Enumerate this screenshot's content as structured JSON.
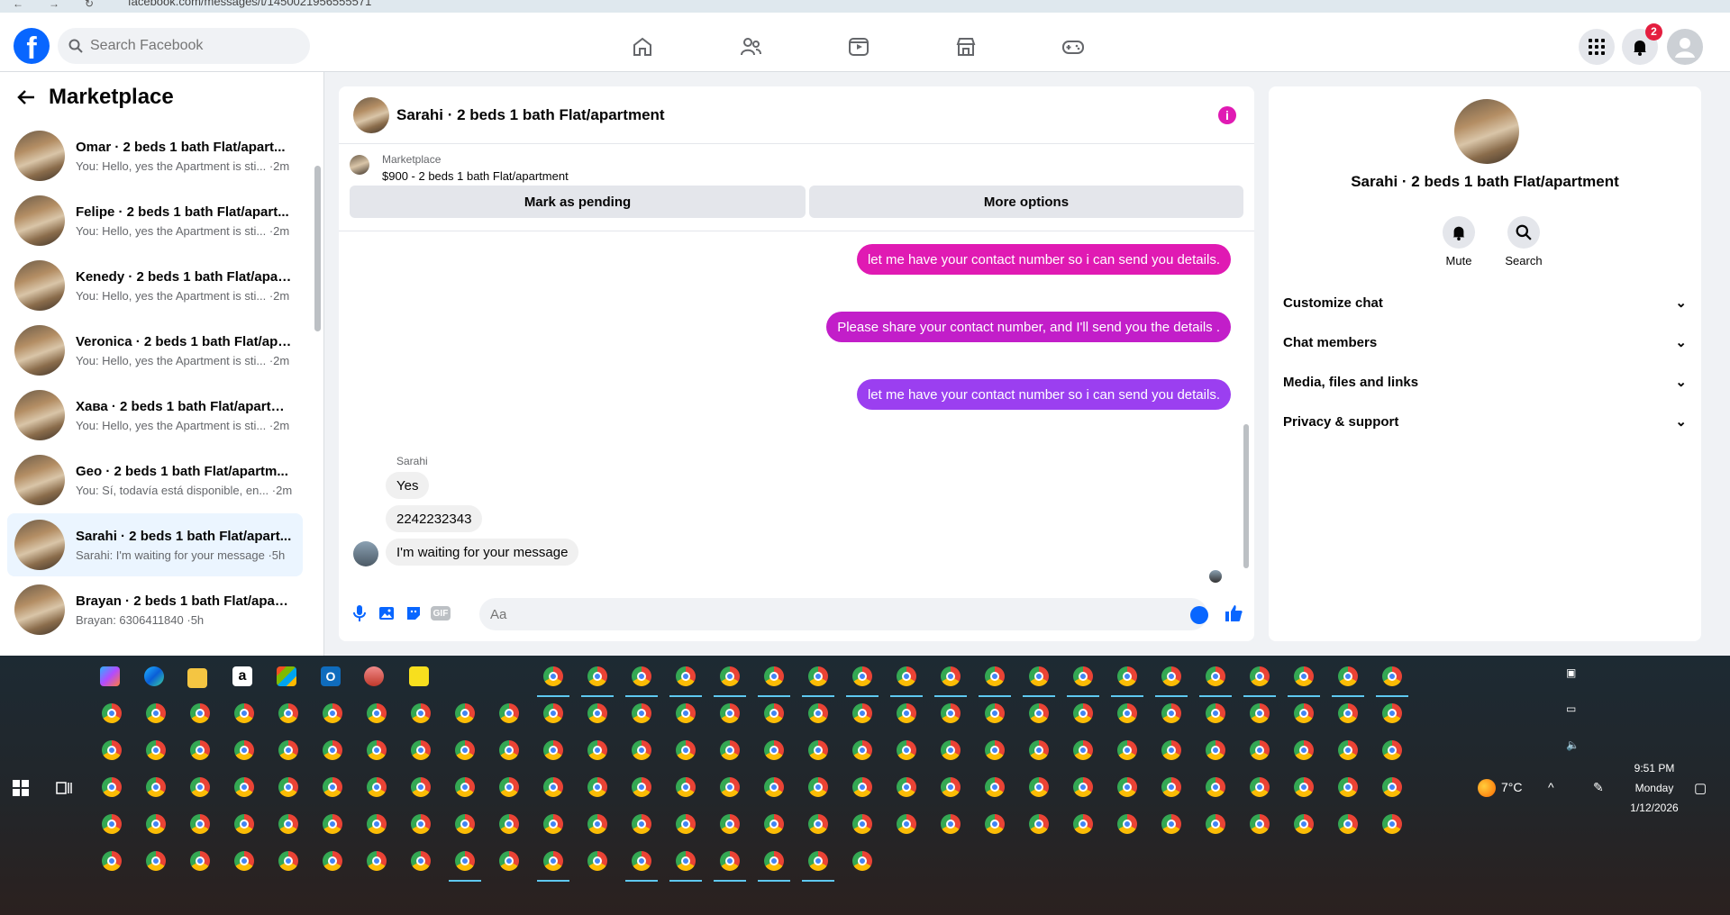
{
  "browser": {
    "url": "facebook.com/messages/t/1450021956555571"
  },
  "topbar": {
    "logo": "f",
    "search_placeholder": "Search Facebook",
    "notification_count": "2",
    "nav_icons": [
      "home-icon",
      "friends-icon",
      "video-icon",
      "marketplace-icon",
      "gaming-icon"
    ]
  },
  "sidebar": {
    "title": "Marketplace",
    "conversations": [
      {
        "name": "Omar · 2 beds 1 bath Flat/apart...",
        "preview": "You: Hello, yes the Apartment is sti... ·2m"
      },
      {
        "name": "Felipe · 2 beds 1 bath Flat/apart...",
        "preview": "You: Hello, yes the Apartment is sti... ·2m"
      },
      {
        "name": "Kenedy · 2 beds 1 bath Flat/apar...",
        "preview": "You: Hello, yes the Apartment is sti... ·2m"
      },
      {
        "name": "Veronica · 2 beds 1 bath Flat/apa...",
        "preview": "You: Hello, yes the Apartment is sti... ·2m"
      },
      {
        "name": "Хава · 2 beds 1 bath Flat/apartm...",
        "preview": "You: Hello, yes the Apartment is sti... ·2m"
      },
      {
        "name": "Geo · 2 beds 1 bath Flat/apartm...",
        "preview": "You: Sí, todavía está disponible, en... ·2m"
      },
      {
        "name": "Sarahi · 2 beds 1 bath Flat/apart...",
        "preview": "Sarahi: I'm waiting for your message ·5h"
      },
      {
        "name": "Brayan · 2 beds 1 bath Flat/apart...",
        "preview": "Brayan: 6306411840 ·5h"
      }
    ]
  },
  "chat": {
    "title": "Sarahi · 2 beds 1 bath Flat/apartment",
    "marketplace_label": "Marketplace",
    "listing": "$900 - 2 beds 1 bath Flat/apartment",
    "mark_pending": "Mark as pending",
    "more_options": "More options",
    "outgoing": [
      "let me have your contact number so i can send you details.",
      "Please share your contact number, and I'll send you the details .",
      "let me have your contact number so i can send you details."
    ],
    "sender": "Sarahi",
    "incoming": [
      "Yes",
      "2242232343",
      "I'm waiting for your message"
    ],
    "input_placeholder": "Aa",
    "gif_label": "GIF",
    "colors": {
      "outgoing_1": "#e01ab3",
      "outgoing_2": "#c21ec9",
      "outgoing_3": "#9b3ff0",
      "accent": "#0866ff"
    }
  },
  "info_panel": {
    "name": "Sarahi · 2 beds 1 bath Flat/apartment",
    "mute": "Mute",
    "search": "Search",
    "sections": [
      "Customize chat",
      "Chat members",
      "Media, files and links",
      "Privacy & support"
    ]
  },
  "taskbar": {
    "weather": "7°C",
    "time": "9:51 PM",
    "day": "Monday",
    "date": "1/12/2026"
  }
}
